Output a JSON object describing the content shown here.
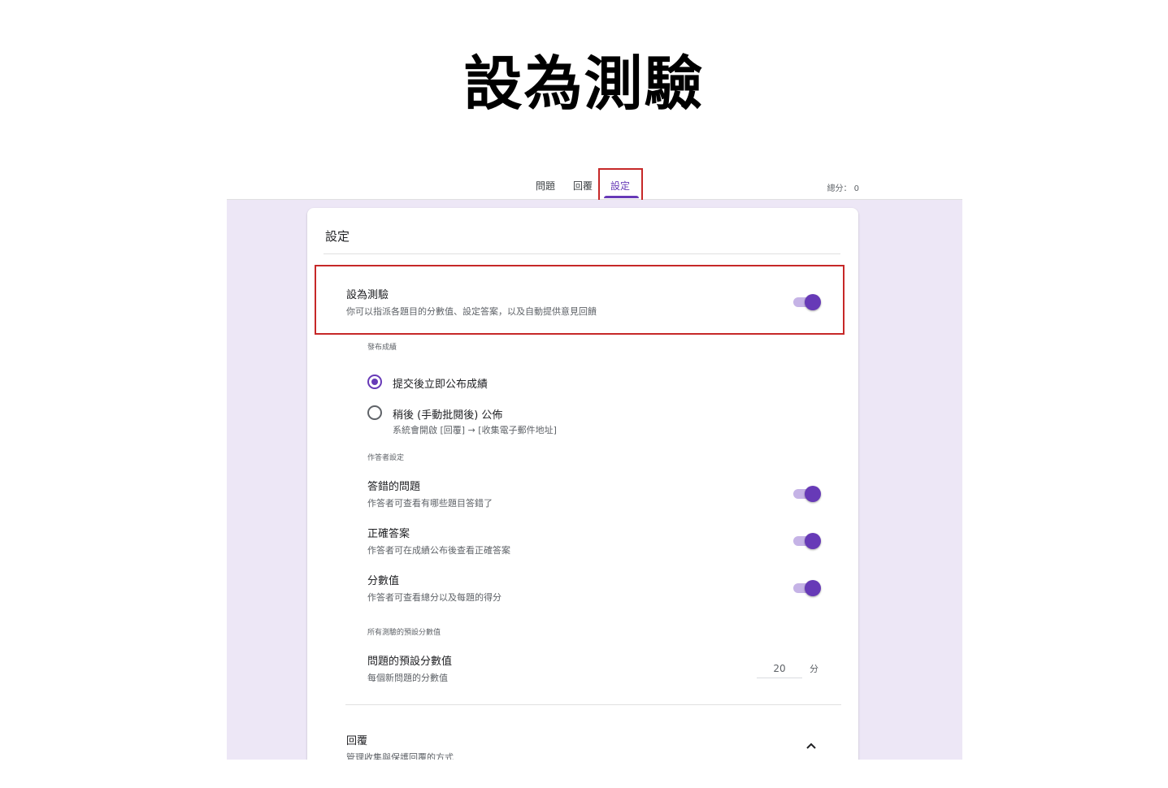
{
  "heading": "設為測驗",
  "tabs": [
    "問題",
    "回覆",
    "設定"
  ],
  "total_score": "總分： 0",
  "card_title": "設定",
  "quiz": {
    "title": "設為測驗",
    "desc": "你可以指派各題目的分數值、設定答案，以及自動提供意見回饋",
    "enabled": true
  },
  "release": {
    "label": "發布成績",
    "option_immediate": "提交後立即公布成績",
    "option_later": "稍後 (手動批閱後) 公佈",
    "option_later_note": "系統會開啟 [回覆] → [收集電子郵件地址]",
    "selected": "immediate"
  },
  "respondent": {
    "label": "作答者設定",
    "missed": {
      "title": "答錯的問題",
      "desc": "作答者可查看有哪些題目答錯了",
      "enabled": true
    },
    "correct": {
      "title": "正確答案",
      "desc": "作答者可在成績公布後查看正確答案",
      "enabled": true
    },
    "values": {
      "title": "分數值",
      "desc": "作答者可查看總分以及每題的得分",
      "enabled": true
    }
  },
  "defaults": {
    "label": "所有測驗的預設分數值",
    "title": "問題的預設分數值",
    "desc": "每個新問題的分數值",
    "value": "20",
    "unit": "分"
  },
  "responses": {
    "title": "回覆",
    "desc": "管理收集與保護回覆的方式"
  },
  "colors": {
    "accent": "#673ab7",
    "background": "#ede7f6",
    "highlight": "#c62828"
  }
}
